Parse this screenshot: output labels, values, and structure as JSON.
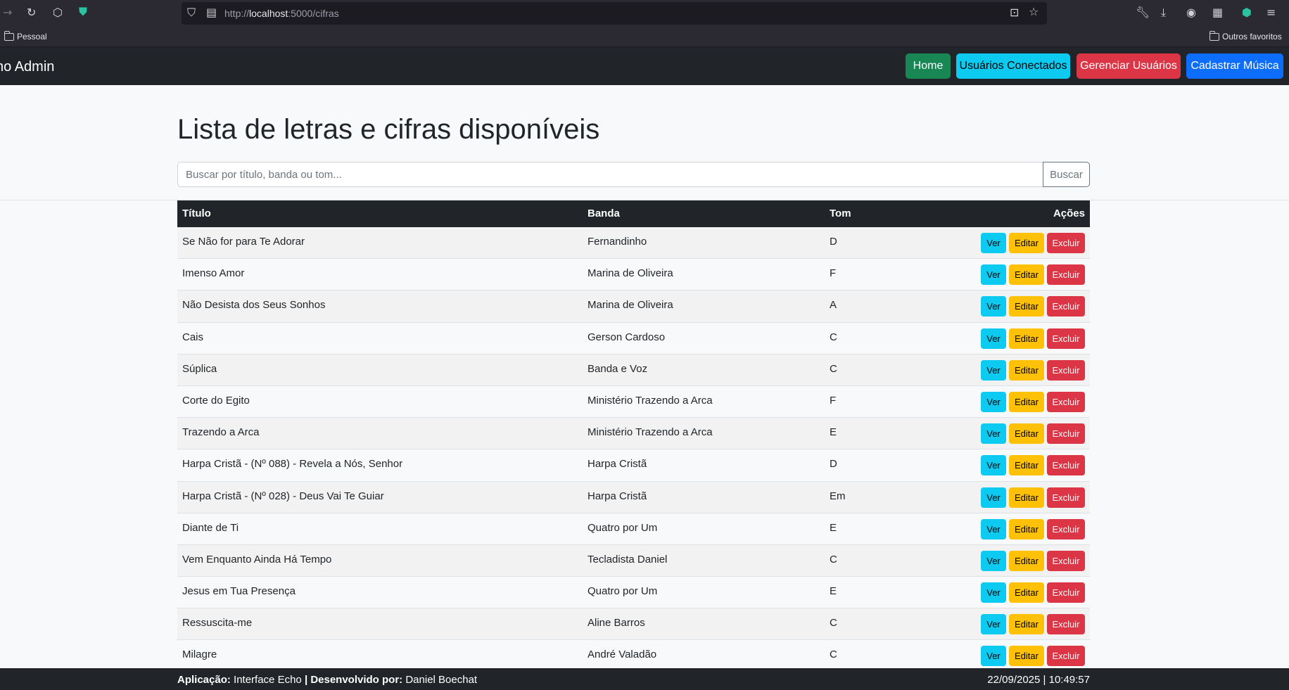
{
  "browser": {
    "url_prefix": "http://",
    "url_host": "localhost",
    "url_rest": ":5000/cifras",
    "bookmarks_left": "Pessoal",
    "bookmarks_right": "Outros favoritos"
  },
  "navbar": {
    "brand": "no Admin",
    "buttons": [
      {
        "label": "Home",
        "color": "#198754"
      },
      {
        "label": "Usuários Conectados",
        "color": "#0dcaf0"
      },
      {
        "label": "Gerenciar Usuários",
        "color": "#dc3545"
      },
      {
        "label": "Cadastrar Música",
        "color": "#0d6efd"
      }
    ]
  },
  "main": {
    "title": "Lista de letras e cifras disponíveis",
    "search_placeholder": "Buscar por título, banda ou tom...",
    "search_button": "Buscar"
  },
  "table": {
    "headers": {
      "title": "Título",
      "band": "Banda",
      "key": "Tom",
      "actions": "Ações"
    },
    "action_labels": {
      "view": "Ver",
      "edit": "Editar",
      "delete": "Excluir"
    },
    "rows": [
      {
        "title": "Se Não for para Te Adorar",
        "band": "Fernandinho",
        "key": "D"
      },
      {
        "title": "Imenso Amor",
        "band": "Marina de Oliveira",
        "key": "F"
      },
      {
        "title": "Não Desista dos Seus Sonhos",
        "band": "Marina de Oliveira",
        "key": "A"
      },
      {
        "title": "Cais",
        "band": "Gerson Cardoso",
        "key": "C"
      },
      {
        "title": "Súplica",
        "band": "Banda e Voz",
        "key": "C"
      },
      {
        "title": "Corte do Egito",
        "band": "Ministério Trazendo a Arca",
        "key": "F"
      },
      {
        "title": "Trazendo a Arca",
        "band": "Ministério Trazendo a Arca",
        "key": "E"
      },
      {
        "title": "Harpa Cristã - (Nº 088) - Revela a Nós, Senhor",
        "band": "Harpa Cristã",
        "key": "D"
      },
      {
        "title": "Harpa Cristã - (Nº 028) - Deus Vai Te Guiar",
        "band": "Harpa Cristã",
        "key": "Em"
      },
      {
        "title": "Diante de Ti",
        "band": "Quatro por Um",
        "key": "E"
      },
      {
        "title": "Vem Enquanto Ainda Há Tempo",
        "band": "Tecladista Daniel",
        "key": "C"
      },
      {
        "title": "Jesus em Tua Presença",
        "band": "Quatro por Um",
        "key": "E"
      },
      {
        "title": "Ressuscita-me",
        "band": "Aline Barros",
        "key": "C"
      },
      {
        "title": "Milagre",
        "band": "André Valadão",
        "key": "C"
      }
    ]
  },
  "footer": {
    "app_label": "Aplicação:",
    "app_name": "Interface Echo",
    "separator": "|",
    "dev_label": "Desenvolvido por:",
    "dev_name": "Daniel Boechat",
    "datetime": "22/09/2025 | 10:49:57"
  }
}
